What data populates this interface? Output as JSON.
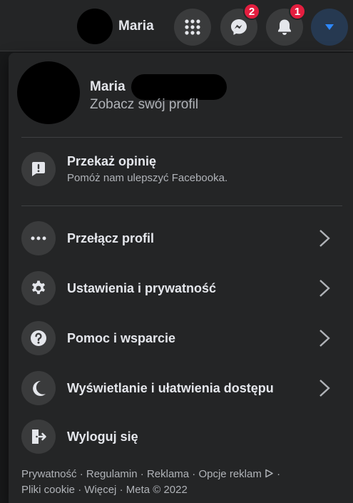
{
  "topbar": {
    "profile_name": "Maria",
    "messenger_badge": "2",
    "notifications_badge": "1"
  },
  "profile": {
    "name": "Maria",
    "subtitle": "Zobacz swój profil"
  },
  "feedback": {
    "label": "Przekaż opinię",
    "subtitle": "Pomóż nam ulepszyć Facebooka."
  },
  "menu_items": [
    {
      "label": "Przełącz profil",
      "icon": "more-dots-icon"
    },
    {
      "label": "Ustawienia i prywatność",
      "icon": "gear-icon"
    },
    {
      "label": "Pomoc i wsparcie",
      "icon": "help-icon"
    },
    {
      "label": "Wyświetlanie i ułatwienia dostępu",
      "icon": "moon-icon"
    },
    {
      "label": "Wyloguj się",
      "icon": "logout-icon"
    }
  ],
  "footer": {
    "privacy": "Prywatność",
    "terms": "Regulamin",
    "ads": "Reklama",
    "ad_choices": "Opcje reklam",
    "cookies": "Pliki cookie",
    "more": "Więcej",
    "meta": "Meta © 2022",
    "separator": "·"
  },
  "colors": {
    "background": "#18191a",
    "surface": "#242526",
    "button": "#3a3b3c",
    "badge": "#e41e3f",
    "accent": "#2d88ff"
  }
}
